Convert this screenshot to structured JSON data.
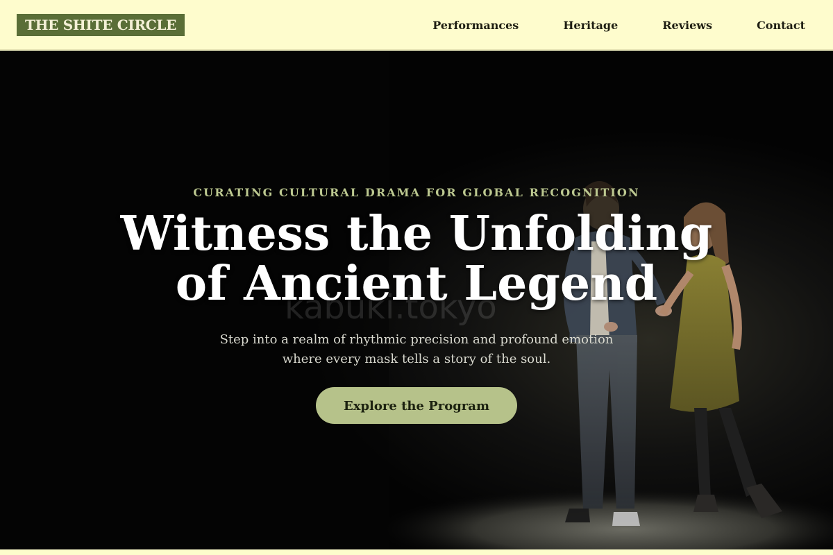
{
  "brand": {
    "logo_text": "THE SHITE CIRCLE"
  },
  "nav": {
    "links": [
      "Performances",
      "Heritage",
      "Reviews",
      "Contact"
    ]
  },
  "hero": {
    "eyebrow": "CURATING CULTURAL DRAMA FOR GLOBAL RECOGNITION",
    "headline_line1": "Witness the Unfolding",
    "headline_line2": "of Ancient Legend",
    "subtitle_line1": "Step into a realm of rhythmic precision and profound emotion",
    "subtitle_line2": "where every mask tells a story of the soul.",
    "cta_label": "Explore the Program",
    "watermark": "kabuki.tokyo"
  },
  "colors": {
    "nav_bg": "#fefccd",
    "logo_bg": "#5a6e37",
    "accent": "#b6c28a",
    "eyebrow": "#bcc890",
    "hero_bg": "#030303"
  }
}
